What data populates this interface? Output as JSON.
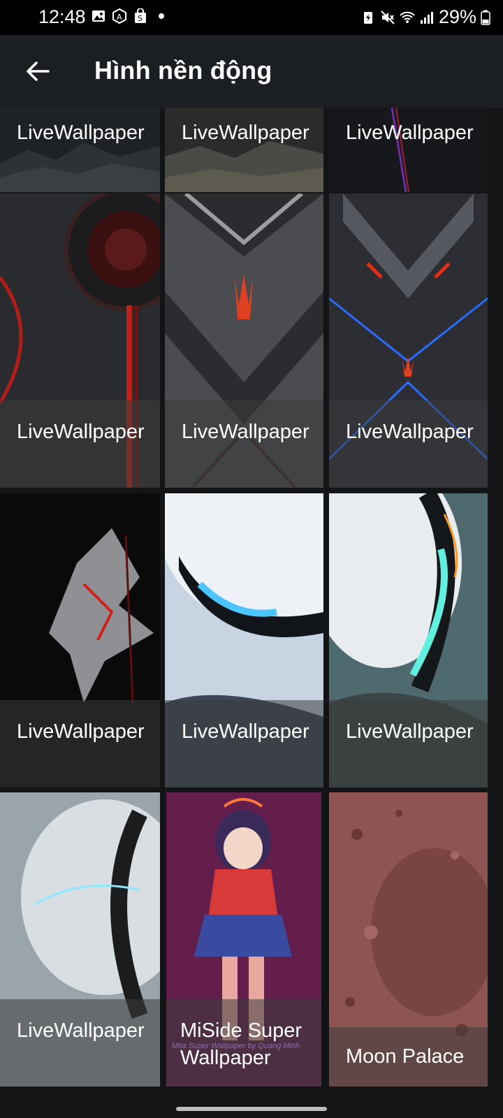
{
  "status_bar": {
    "time": "12:48",
    "battery": "29%",
    "left_icons": [
      "image-icon",
      "a-badge-icon",
      "shopping-bag-icon",
      "dot-icon"
    ],
    "right_icons": [
      "battery-saver-icon",
      "mute-icon",
      "wifi-icon",
      "signal-icon",
      "battery-icon"
    ]
  },
  "app_bar": {
    "title": "Hình nền động",
    "back_icon": "arrow-left-icon"
  },
  "wallpapers": [
    {
      "label": "LiveWallpaper",
      "theme": "dark-mountains"
    },
    {
      "label": "LiveWallpaper",
      "theme": "grey-hills"
    },
    {
      "label": "LiveWallpaper",
      "theme": "dark-abstract"
    },
    {
      "label": "LiveWallpaper",
      "theme": "red-fan-tech"
    },
    {
      "label": "LiveWallpaper",
      "theme": "grey-chevron-logo"
    },
    {
      "label": "LiveWallpaper",
      "theme": "dark-blue-x-logo"
    },
    {
      "label": "LiveWallpaper",
      "theme": "black-red-shards"
    },
    {
      "label": "LiveWallpaper",
      "theme": "white-robot-blue"
    },
    {
      "label": "LiveWallpaper",
      "theme": "white-robot-teal"
    },
    {
      "label": "LiveWallpaper",
      "theme": "white-helmet"
    },
    {
      "label": "MiSide Super Wallpaper",
      "theme": "anime-girl",
      "watermark": "Mita Super Wallpaper by Quang Minh"
    },
    {
      "label": "Moon Palace",
      "theme": "moon-surface"
    }
  ],
  "colors": {
    "background": "#121416",
    "app_bar": "#1b1e22",
    "status_bar": "#000000",
    "text": "#ffffff"
  }
}
